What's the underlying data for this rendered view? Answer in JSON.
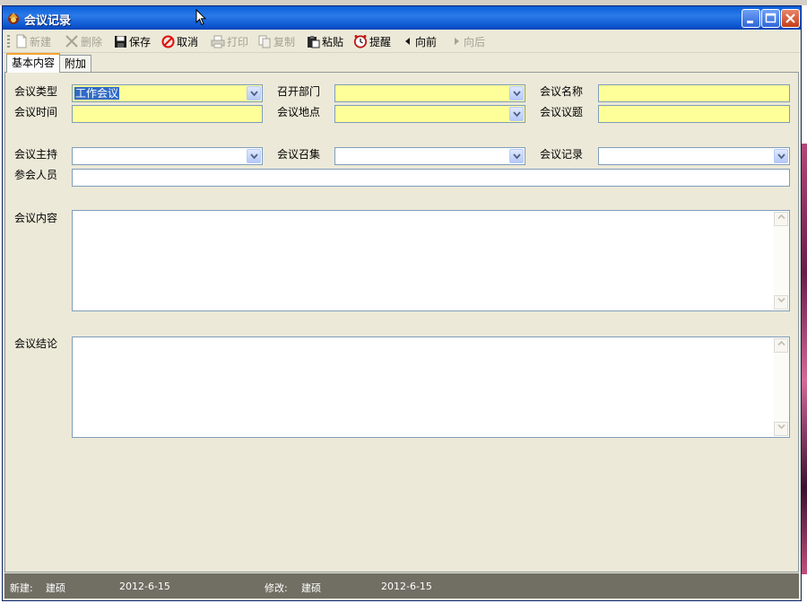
{
  "window": {
    "title": "会议记录",
    "controls": [
      "minimize",
      "maximize",
      "close"
    ]
  },
  "toolbar": {
    "items": [
      {
        "label": "新建",
        "icon": "new-document-icon",
        "enabled": false
      },
      {
        "label": "删除",
        "icon": "delete-x-icon",
        "enabled": false
      },
      {
        "label": "保存",
        "icon": "floppy-save-icon",
        "enabled": true
      },
      {
        "label": "取消",
        "icon": "cancel-circle-icon",
        "enabled": true
      },
      {
        "label": "打印",
        "icon": "printer-icon",
        "enabled": false
      },
      {
        "label": "复制",
        "icon": "copy-icon",
        "enabled": false
      },
      {
        "label": "粘贴",
        "icon": "paste-icon",
        "enabled": true
      },
      {
        "label": "提醒",
        "icon": "alarm-clock-icon",
        "enabled": true
      },
      {
        "label": "向前",
        "icon": "triangle-left-icon",
        "enabled": true
      },
      {
        "label": "向后",
        "icon": "triangle-right-icon",
        "enabled": false
      }
    ]
  },
  "tabs": [
    {
      "label": "基本内容",
      "active": true
    },
    {
      "label": "附加",
      "active": false
    }
  ],
  "form": {
    "meeting_type": {
      "label": "会议类型",
      "value": "工作会议"
    },
    "host_department": {
      "label": "召开部门",
      "value": ""
    },
    "meeting_name": {
      "label": "会议名称",
      "value": ""
    },
    "meeting_time": {
      "label": "会议时间",
      "value": ""
    },
    "meeting_location": {
      "label": "会议地点",
      "value": ""
    },
    "meeting_topic": {
      "label": "会议议题",
      "value": ""
    },
    "meeting_host": {
      "label": "会议主持",
      "value": ""
    },
    "meeting_convener": {
      "label": "会议召集",
      "value": ""
    },
    "meeting_recorder": {
      "label": "会议记录",
      "value": ""
    },
    "attendees": {
      "label": "参会人员",
      "value": ""
    },
    "meeting_content": {
      "label": "会议内容",
      "value": ""
    },
    "meeting_conclusion": {
      "label": "会议结论",
      "value": ""
    }
  },
  "status": {
    "created_label": "新建:",
    "created_by": "建硕",
    "created_date": "2012-6-15",
    "modified_label": "修改:",
    "modified_by": "建硕",
    "modified_date": "2012-6-15"
  },
  "colors": {
    "required_field": "#ffff99",
    "titlebar": "#0a5fd8",
    "statusbar": "#716f64",
    "active_tab_accent": "#f5a331"
  }
}
